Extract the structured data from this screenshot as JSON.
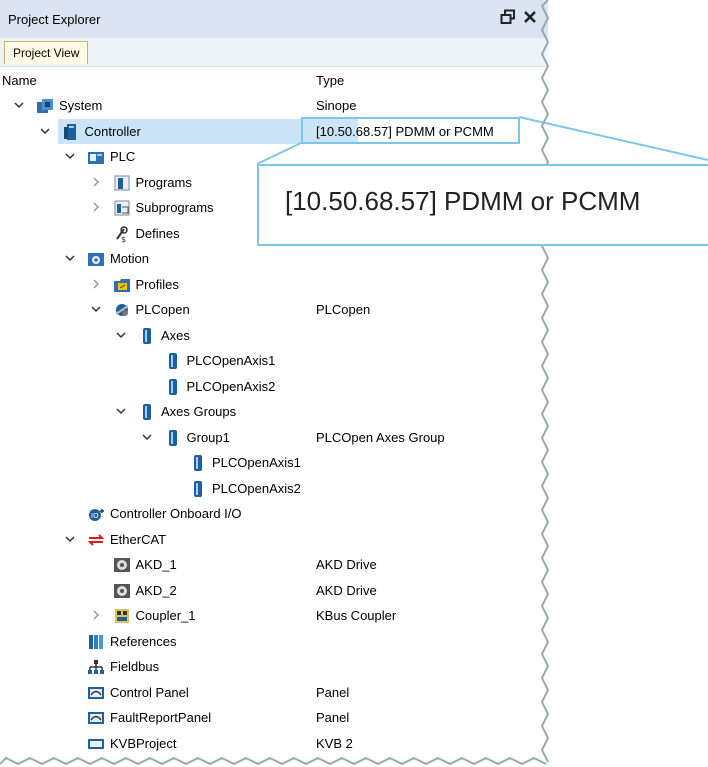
{
  "window": {
    "title": "Project Explorer"
  },
  "tabs": [
    {
      "label": "Project View"
    }
  ],
  "columns": {
    "name": "Name",
    "type": "Type"
  },
  "tree": [
    {
      "id": "system",
      "label": "System",
      "type": "Sinope",
      "depth": 0,
      "expander": "expanded",
      "icon": "system-icon"
    },
    {
      "id": "controller",
      "label": "Controller",
      "type": "[10.50.68.57] PDMM or PCMM",
      "depth": 1,
      "expander": "expanded",
      "icon": "controller-icon",
      "selected": true
    },
    {
      "id": "plc",
      "label": "PLC",
      "type": "",
      "depth": 2,
      "expander": "expanded",
      "icon": "plc-icon"
    },
    {
      "id": "programs",
      "label": "Programs",
      "type": "",
      "depth": 3,
      "expander": "collapsed",
      "icon": "programs-icon"
    },
    {
      "id": "subprograms",
      "label": "Subprograms",
      "type": "",
      "depth": 3,
      "expander": "collapsed",
      "icon": "subprograms-icon"
    },
    {
      "id": "defines",
      "label": "Defines",
      "type": "",
      "depth": 3,
      "expander": "none",
      "icon": "defines-icon"
    },
    {
      "id": "motion",
      "label": "Motion",
      "type": "",
      "depth": 2,
      "expander": "expanded",
      "icon": "motion-icon"
    },
    {
      "id": "profiles",
      "label": "Profiles",
      "type": "",
      "depth": 3,
      "expander": "collapsed",
      "icon": "profiles-folder-icon"
    },
    {
      "id": "plcopen",
      "label": "PLCopen",
      "type": "PLCopen",
      "depth": 3,
      "expander": "expanded",
      "icon": "plcopen-icon"
    },
    {
      "id": "axes",
      "label": "Axes",
      "type": "",
      "depth": 4,
      "expander": "expanded",
      "icon": "axis-icon"
    },
    {
      "id": "axis1",
      "label": "PLCOpenAxis1",
      "type": "",
      "depth": 5,
      "expander": "none",
      "icon": "axis-icon"
    },
    {
      "id": "axis2",
      "label": "PLCOpenAxis2",
      "type": "",
      "depth": 5,
      "expander": "none",
      "icon": "axis-icon"
    },
    {
      "id": "axesgroups",
      "label": "Axes Groups",
      "type": "",
      "depth": 4,
      "expander": "expanded",
      "icon": "axis-icon"
    },
    {
      "id": "group1",
      "label": "Group1",
      "type": "PLCOpen Axes Group",
      "depth": 5,
      "expander": "expanded",
      "icon": "axis-icon"
    },
    {
      "id": "g1axis1",
      "label": "PLCOpenAxis1",
      "type": "",
      "depth": 6,
      "expander": "none",
      "icon": "axis-icon"
    },
    {
      "id": "g1axis2",
      "label": "PLCOpenAxis2",
      "type": "",
      "depth": 6,
      "expander": "none",
      "icon": "axis-icon"
    },
    {
      "id": "onboardio",
      "label": "Controller Onboard I/O",
      "type": "",
      "depth": 2,
      "expander": "none",
      "icon": "onboard-io-icon"
    },
    {
      "id": "ethercat",
      "label": "EtherCAT",
      "type": "",
      "depth": 2,
      "expander": "expanded",
      "icon": "ethercat-icon"
    },
    {
      "id": "akd1",
      "label": "AKD_1",
      "type": "AKD Drive",
      "depth": 3,
      "expander": "none",
      "icon": "drive-icon"
    },
    {
      "id": "akd2",
      "label": "AKD_2",
      "type": "AKD Drive",
      "depth": 3,
      "expander": "none",
      "icon": "drive-icon"
    },
    {
      "id": "coupler1",
      "label": "Coupler_1",
      "type": "KBus Coupler",
      "depth": 3,
      "expander": "collapsed",
      "icon": "coupler-icon"
    },
    {
      "id": "references",
      "label": "References",
      "type": "",
      "depth": 2,
      "expander": "none",
      "icon": "references-icon"
    },
    {
      "id": "fieldbus",
      "label": "Fieldbus",
      "type": "",
      "depth": 2,
      "expander": "none",
      "icon": "fieldbus-icon"
    },
    {
      "id": "controlpanel",
      "label": "Control Panel",
      "type": "Panel",
      "depth": 2,
      "expander": "none",
      "icon": "panel-icon"
    },
    {
      "id": "faultpanel",
      "label": "FaultReportPanel",
      "type": "Panel",
      "depth": 2,
      "expander": "none",
      "icon": "panel-icon"
    },
    {
      "id": "kvbproject",
      "label": "KVBProject",
      "type": "KVB 2",
      "depth": 2,
      "expander": "none",
      "icon": "kvb-icon"
    }
  ],
  "callout": {
    "text": "[10.50.68.57] PDMM or PCMM"
  },
  "colors": {
    "selection": "#cce4f7",
    "callout_border": "#7fc6e6",
    "titlebar": "#d9e3f2",
    "tab_bg": "#fffbe6"
  }
}
